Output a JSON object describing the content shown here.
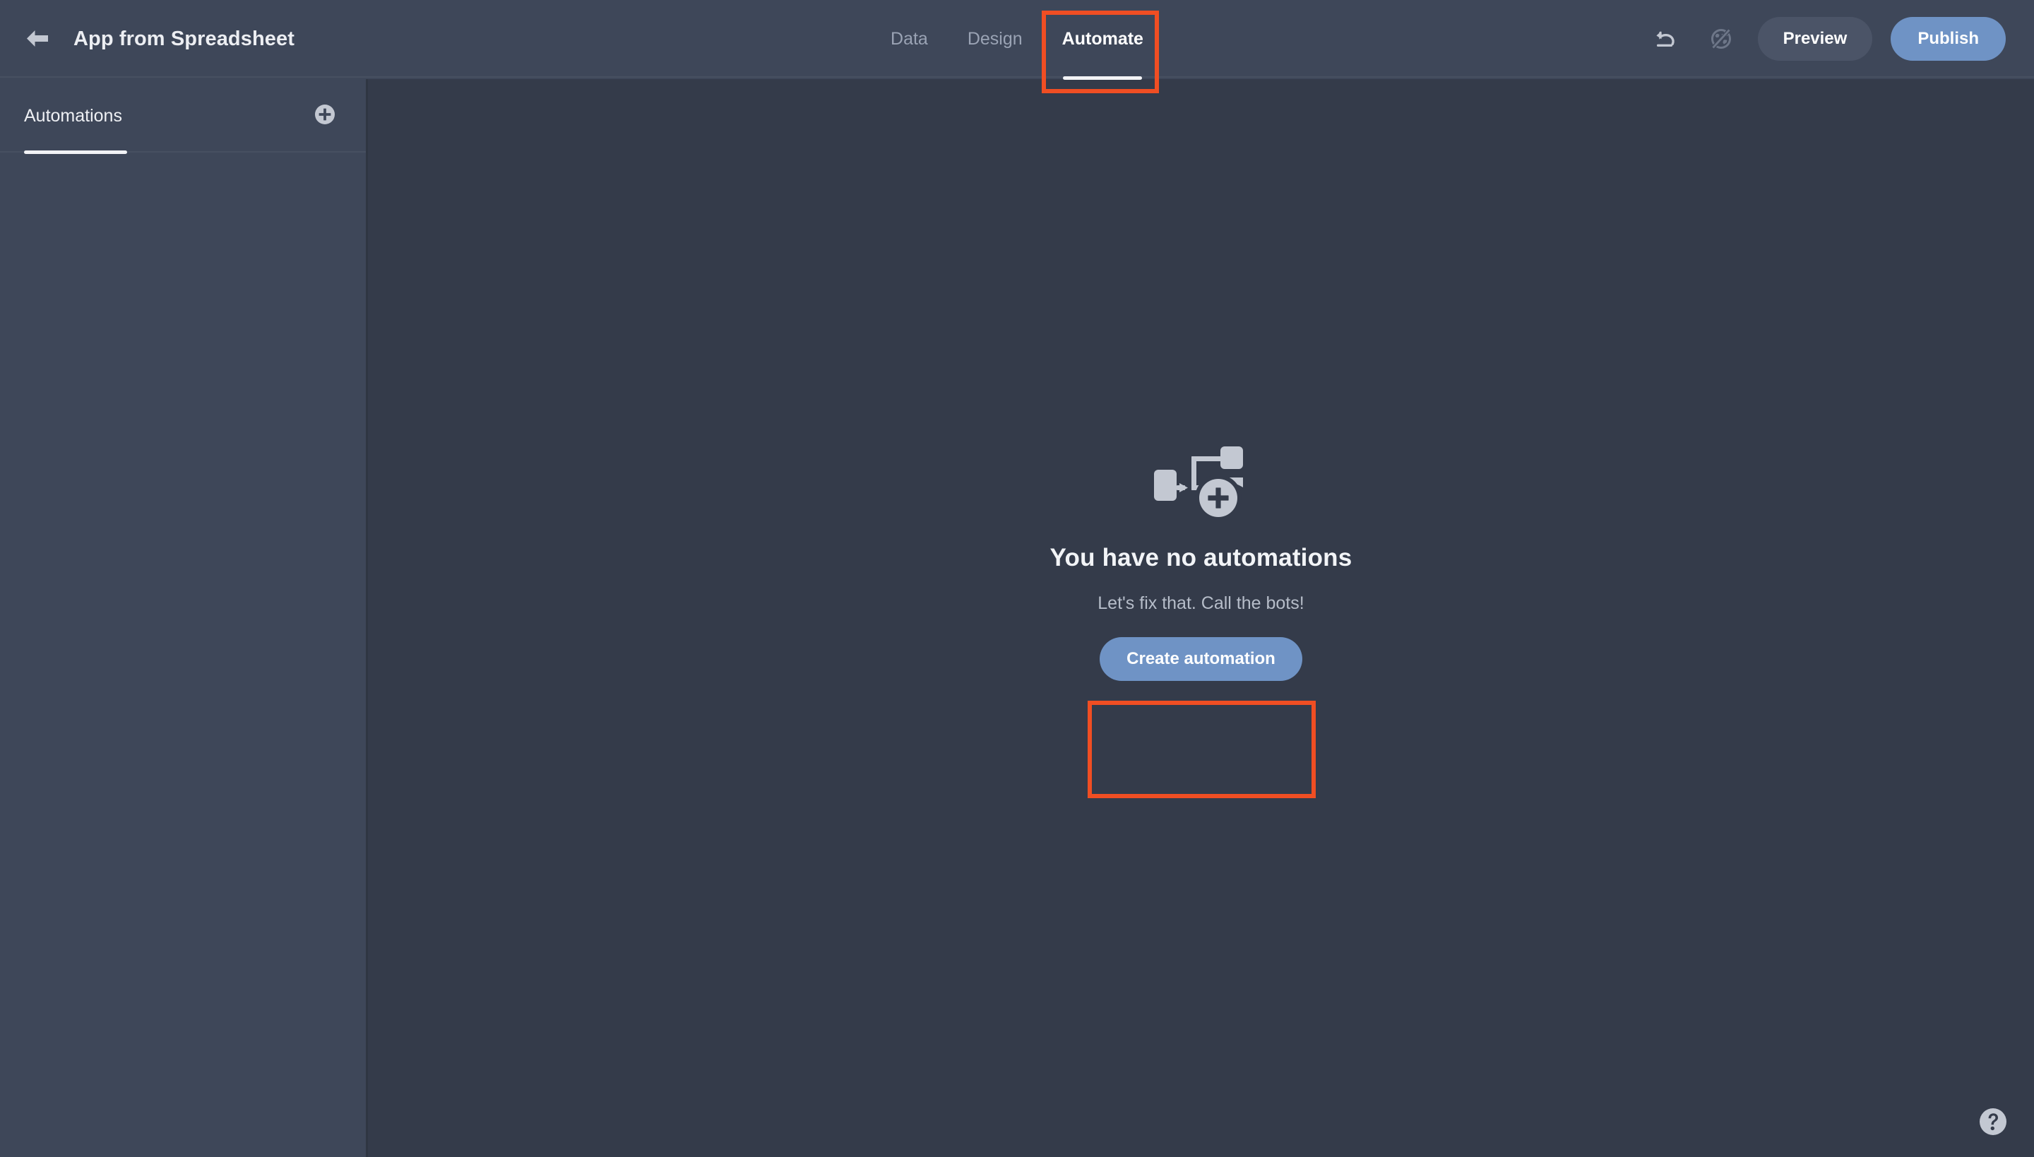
{
  "header": {
    "back_icon": "arrow-left-icon",
    "title": "App from Spreadsheet",
    "tabs": [
      {
        "label": "Data",
        "active": false
      },
      {
        "label": "Design",
        "active": false
      },
      {
        "label": "Automate",
        "active": true
      }
    ],
    "actions": {
      "undo_icon": "undo-icon",
      "unpublished_icon": "globe-slash-icon",
      "preview_label": "Preview",
      "publish_label": "Publish"
    }
  },
  "sidebar": {
    "tab_label": "Automations",
    "add_icon": "plus-circle-icon",
    "items": []
  },
  "main": {
    "empty_state": {
      "illustration_icon": "automation-flow-add-icon",
      "title": "You have no automations",
      "subtitle": "Let's fix that. Call the bots!",
      "cta_label": "Create automation"
    },
    "help_icon": "help-circle-icon"
  },
  "annotations": [
    {
      "name": "automate-tab-highlight",
      "target": "Automate"
    },
    {
      "name": "create-automation-highlight",
      "target": "Create automation"
    }
  ],
  "colors": {
    "header_bg": "#3e4759",
    "sidebar_bg": "#3e4759",
    "main_bg": "#343b4a",
    "accent_blue": "#6f93c5",
    "preview_btn": "#4b5467",
    "annotation_red": "#f04e23",
    "text_primary": "#f2f4f7",
    "text_muted": "#9aa3b4",
    "icon_gray": "#c3c8d2"
  }
}
